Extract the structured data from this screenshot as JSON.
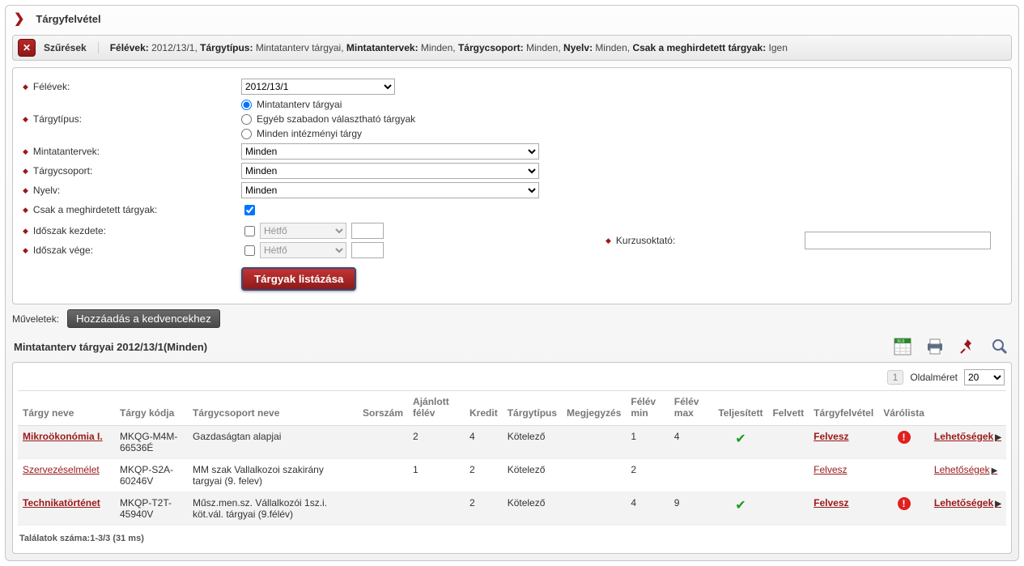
{
  "header": {
    "title": "Tárgyfelvétel"
  },
  "filter_bar": {
    "title": "Szűrések",
    "summary_parts": {
      "felevek_k": "Félévek:",
      "felevek_v": "2012/13/1,",
      "targytipus_k": "Tárgytípus:",
      "targytipus_v": "Mintatanterv tárgyai,",
      "mintatantervek_k": "Mintatantervek:",
      "mintatantervek_v": "Minden,",
      "targycsoport_k": "Tárgycsoport:",
      "targycsoport_v": "Minden,",
      "nyelv_k": "Nyelv:",
      "nyelv_v": "Minden,",
      "csak_k": "Csak a meghirdetett tárgyak:",
      "csak_v": "Igen"
    }
  },
  "form": {
    "labels": {
      "felevek": "Félévek:",
      "targytipus": "Tárgytípus:",
      "mintatantervek": "Mintatantervek:",
      "targycsoport": "Tárgycsoport:",
      "nyelv": "Nyelv:",
      "csak": "Csak a meghirdetett tárgyak:",
      "idoszak_kezdete": "Időszak kezdete:",
      "idoszak_vege": "Időszak vége:",
      "kurzusoktato": "Kurzusoktató:"
    },
    "values": {
      "felevek": "2012/13/1",
      "mintatantervek": "Minden",
      "targycsoport": "Minden",
      "nyelv": "Minden",
      "day1": "Hétfő",
      "day2": "Hétfő"
    },
    "radios": {
      "r1": "Mintatanterv tárgyai",
      "r2": "Egyéb szabadon választható tárgyak",
      "r3": "Minden intézményi tárgy"
    },
    "submit": "Tárgyak listázása"
  },
  "actions": {
    "label": "Műveletek:",
    "fav": "Hozzáadás a kedvencekhez"
  },
  "results": {
    "title": "Mintatanterv tárgyai 2012/13/1(Minden)",
    "pager": {
      "page": "1",
      "label": "Oldalméret",
      "size": "20"
    },
    "columns": {
      "c1": "Tárgy neve",
      "c2": "Tárgy kódja",
      "c3": "Tárgycsoport neve",
      "c4": "Sorszám",
      "c5": "Ajánlott félév",
      "c6": "Kredit",
      "c7": "Tárgytípus",
      "c8": "Megjegyzés",
      "c9": "Félév min",
      "c10": "Félév max",
      "c11": "Teljesített",
      "c12": "Felvett",
      "c13": "Tárgyfelvétel",
      "c14": "Várólista",
      "c15": ""
    },
    "rows": [
      {
        "name": "Mikroökonómia I.",
        "code": "MKQG-M4M-66536É",
        "group": "Gazdaságtan alapjai",
        "sorszam": "",
        "ajanlott": "2",
        "kredit": "4",
        "tipus": "Kötelező",
        "megj": "",
        "fmin": "1",
        "fmax": "4",
        "telj": true,
        "felvett": "",
        "felvesz": "Felvesz",
        "warn": true,
        "opt": "Lehetőségek",
        "bold": true
      },
      {
        "name": "Szervezéselmélet",
        "code": "MKQP-S2A-60246V",
        "group": "MM szak Vallalkozoi szakirány targyai (9. felev)",
        "sorszam": "",
        "ajanlott": "1",
        "kredit": "2",
        "tipus": "Kötelező",
        "megj": "",
        "fmin": "2",
        "fmax": "",
        "telj": false,
        "felvett": "",
        "felvesz": "Felvesz",
        "warn": false,
        "opt": "Lehetőségek",
        "bold": false
      },
      {
        "name": "Technikatörténet",
        "code": "MKQP-T2T-45940V",
        "group": "Műsz.men.sz. Vállalkozói 1sz.i. köt.vál. tárgyai (9.félév)",
        "sorszam": "",
        "ajanlott": "",
        "kredit": "2",
        "tipus": "Kötelező",
        "megj": "",
        "fmin": "4",
        "fmax": "9",
        "telj": true,
        "felvett": "",
        "felvesz": "Felvesz",
        "warn": true,
        "opt": "Lehetőségek",
        "bold": true
      }
    ],
    "footer": "Találatok száma:1-3/3 (31 ms)"
  }
}
